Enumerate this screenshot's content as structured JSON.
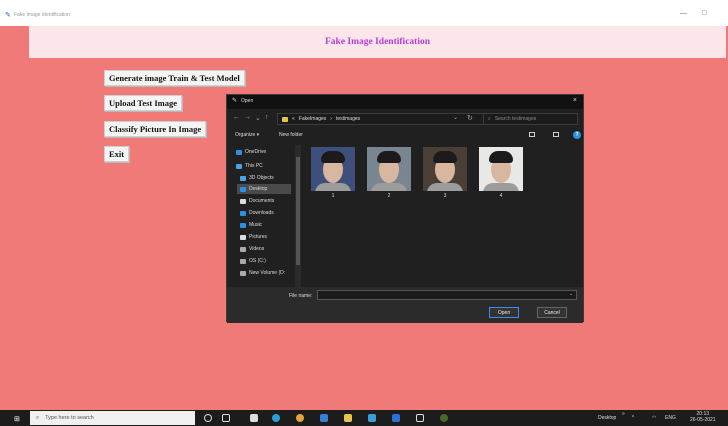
{
  "window": {
    "title": "Fake Image Identification",
    "min_glyph": "—",
    "max_glyph": "□"
  },
  "app": {
    "banner": "Fake Image Identification",
    "buttons": [
      {
        "label": "Generate image Train & Test Model"
      },
      {
        "label": "Upload Test Image"
      },
      {
        "label": "Classify Picture In Image"
      },
      {
        "label": "Exit"
      }
    ]
  },
  "dialog": {
    "title": "Open",
    "close": "×",
    "nav": {
      "back": "←",
      "forward": "→",
      "dropdown": "⌄",
      "up": "↑",
      "refresh": "↻"
    },
    "breadcrumb": [
      "FakeImages",
      "testimages"
    ],
    "breadcrumb_sep": "›",
    "breadcrumb_prefix": "«",
    "search_placeholder": "Search testimages",
    "search_glyph": "⌕",
    "organize": "Organize ▾",
    "new_folder": "New folder",
    "help": "?",
    "sidebar": [
      {
        "label": "OneDrive",
        "icon": "cloud-icon",
        "color": "#2b8fe6"
      },
      {
        "label": "This PC",
        "icon": "computer-icon",
        "color": "#4aa3e6"
      },
      {
        "label": "3D Objects",
        "icon": "cube-icon",
        "color": "#4aa3e6"
      },
      {
        "label": "Desktop",
        "icon": "desktop-icon",
        "color": "#2b8fe6",
        "selected": true
      },
      {
        "label": "Documents",
        "icon": "document-icon",
        "color": "#dddddd"
      },
      {
        "label": "Downloads",
        "icon": "download-icon",
        "color": "#2b8fe6"
      },
      {
        "label": "Music",
        "icon": "music-icon",
        "color": "#2b8fe6"
      },
      {
        "label": "Pictures",
        "icon": "pictures-icon",
        "color": "#dddddd"
      },
      {
        "label": "Videos",
        "icon": "video-icon",
        "color": "#aaaaaa"
      },
      {
        "label": "OS (C:)",
        "icon": "drive-icon",
        "color": "#aaaaaa"
      },
      {
        "label": "New Volume (D:",
        "icon": "drive-icon",
        "color": "#aaaaaa"
      }
    ],
    "files": [
      {
        "label": "1",
        "bg": "#3d4f7a"
      },
      {
        "label": "2",
        "bg": "#7a8592"
      },
      {
        "label": "3",
        "bg": "#4a3f36"
      },
      {
        "label": "4",
        "bg": "#e8e8e6"
      }
    ],
    "filename_label": "File name:",
    "filename_value": "",
    "open_label": "Open",
    "cancel_label": "Cancel"
  },
  "taskbar": {
    "start_glyph": "⊞",
    "search_glyph": "⌕",
    "search_placeholder": "Type here to search",
    "tray_desktop": "Desktop",
    "tray_chevron": "»",
    "tray_up": "^",
    "lang": "ENG",
    "time": "20:13",
    "date": "26-05-2021"
  },
  "colors": {
    "app_bg": "#f07a78",
    "banner_bg": "#fde6ea",
    "banner_text": "#b13fd4",
    "dialog_bg": "#202020",
    "taskbar_bg": "#1c1c1c"
  }
}
